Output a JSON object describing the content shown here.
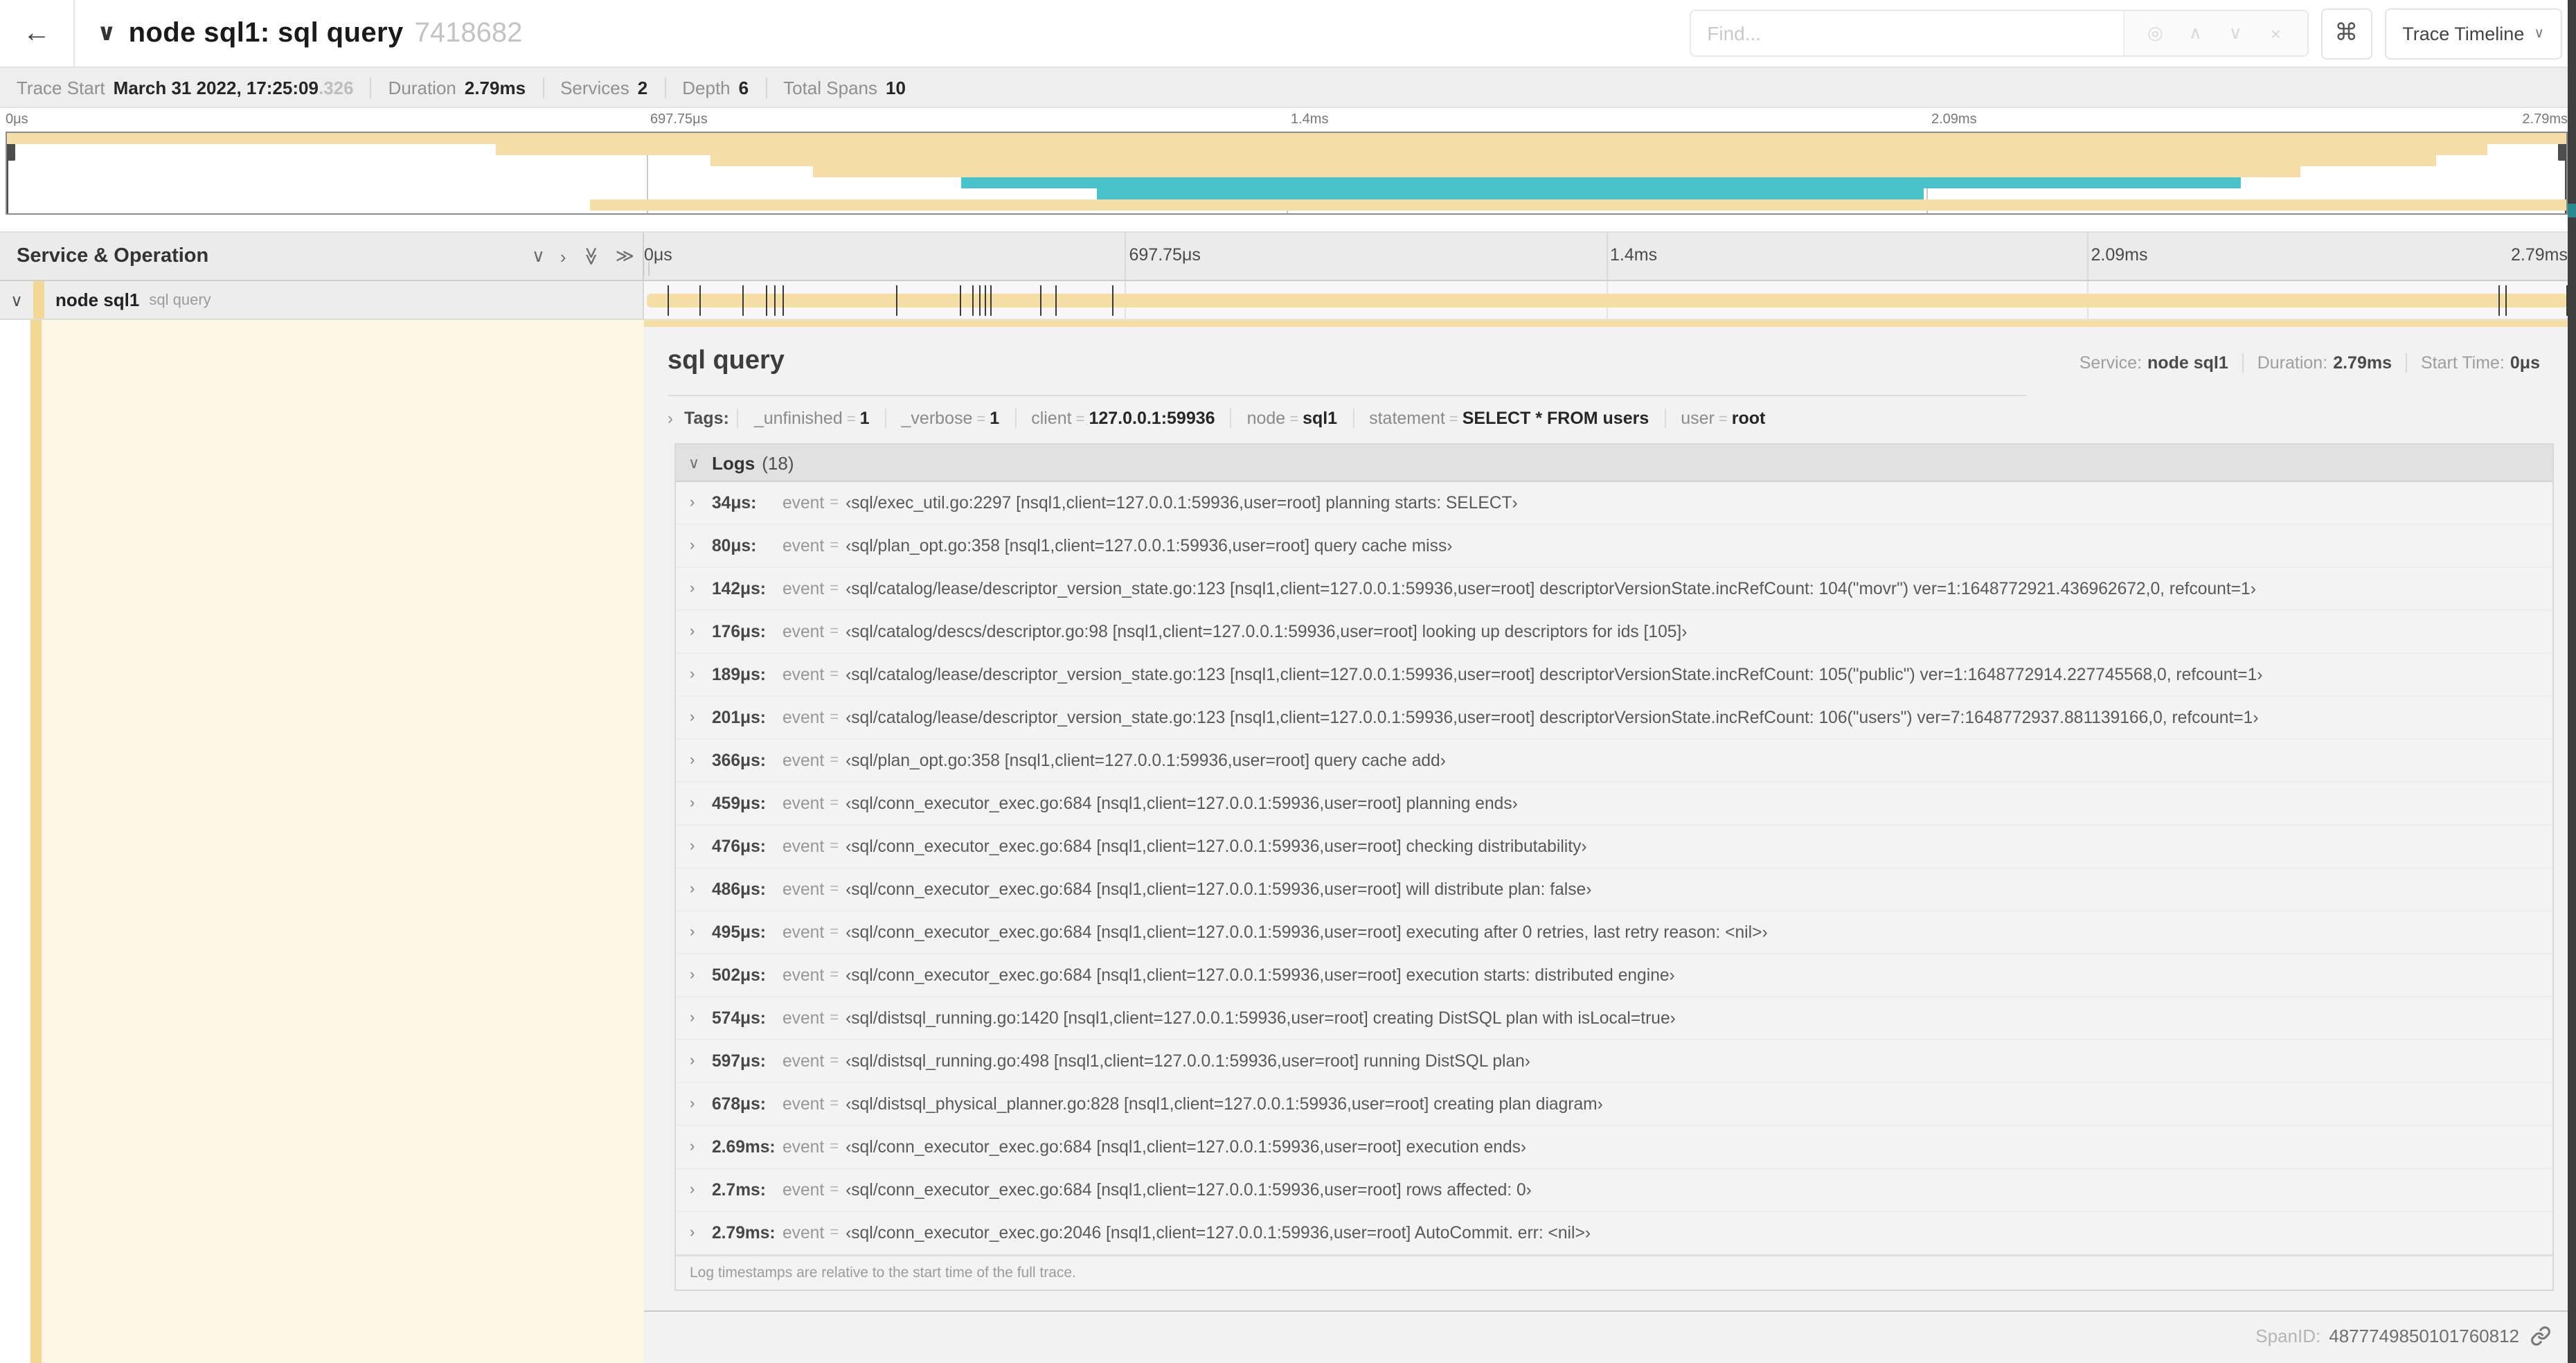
{
  "header": {
    "back": "←",
    "collapse_caret": "∨",
    "title": "node sql1: sql query",
    "trace_id": "7418682",
    "find_placeholder": "Find...",
    "find_icons": {
      "locate": "◎",
      "prev": "∧",
      "next": "∨",
      "clear": "×"
    },
    "shortcut": "⌘",
    "view_select": "Trace Timeline",
    "view_caret": "∨"
  },
  "trace_info": {
    "items": [
      {
        "label": "Trace Start",
        "value": "March 31 2022, 17:25:09",
        "extra": ".326"
      },
      {
        "label": "Duration",
        "value": "2.79ms",
        "extra": ""
      },
      {
        "label": "Services",
        "value": "2",
        "extra": ""
      },
      {
        "label": "Depth",
        "value": "6",
        "extra": ""
      },
      {
        "label": "Total Spans",
        "value": "10",
        "extra": ""
      }
    ]
  },
  "colors": {
    "span_tan": "#f6dfa6",
    "span_tan_dark": "#f3d794",
    "span_teal": "#48c3c9",
    "expanded_cream": "#fdf6e4"
  },
  "minimap": {
    "rows": [
      {
        "start": 0,
        "end": 100,
        "color": "tan"
      },
      {
        "start": 19.1,
        "end": 96.9,
        "color": "tan"
      },
      {
        "start": 27.5,
        "end": 94.9,
        "color": "tan"
      },
      {
        "start": 31.5,
        "end": 89.6,
        "color": "tan"
      },
      {
        "start": 37.3,
        "end": 87.3,
        "color": "teal"
      },
      {
        "start": 42.6,
        "end": 74.9,
        "color": "teal"
      },
      {
        "start": 22.8,
        "end": 100,
        "color": "tan"
      }
    ]
  },
  "timeline": {
    "left_header": "Service & Operation",
    "icons": {
      "collapse_one": "∨",
      "expand_one": "›",
      "collapse_all": "≫",
      "expand_all": "≫"
    },
    "resizer": "||",
    "ticks": [
      {
        "label": "0μs",
        "pos": 0
      },
      {
        "label": "697.75μs",
        "pos": 25
      },
      {
        "label": "1.4ms",
        "pos": 50
      },
      {
        "label": "2.09ms",
        "pos": 75
      },
      {
        "label": "2.79ms",
        "pos": 100
      }
    ],
    "row": {
      "chevron": "∨",
      "service": "node sql1",
      "operation": "sql query",
      "bar": {
        "start": 0.15,
        "end": 100
      },
      "markers": [
        1.22,
        2.87,
        5.09,
        6.31,
        6.78,
        7.2,
        13.12,
        16.45,
        17.06,
        17.42,
        17.74,
        18.0,
        20.57,
        21.4,
        24.3,
        96.42,
        96.77,
        99.95
      ]
    }
  },
  "detail": {
    "operation": "sql query",
    "meta": [
      {
        "label": "Service:",
        "value": "node sql1"
      },
      {
        "label": "Duration:",
        "value": "2.79ms"
      },
      {
        "label": "Start Time:",
        "value": "0μs"
      }
    ],
    "tags": {
      "chevron": "›",
      "title": "Tags:",
      "eq": "=",
      "items": [
        {
          "key": "_unfinished",
          "value": "1"
        },
        {
          "key": "_verbose",
          "value": "1"
        },
        {
          "key": "client",
          "value": "127.0.0.1:59936"
        },
        {
          "key": "node",
          "value": "sql1"
        },
        {
          "key": "statement",
          "value": "SELECT * FROM users"
        },
        {
          "key": "user",
          "value": "root"
        }
      ]
    },
    "logs": {
      "chevron": "∨",
      "row_chevron": "›",
      "title": "Logs",
      "count": "(18)",
      "event_key": "event",
      "eq": "=",
      "entries": [
        {
          "time": "34μs:",
          "value": "‹sql/exec_util.go:2297 [nsql1,client=127.0.0.1:59936,user=root] planning starts: SELECT›"
        },
        {
          "time": "80μs:",
          "value": "‹sql/plan_opt.go:358 [nsql1,client=127.0.0.1:59936,user=root] query cache miss›"
        },
        {
          "time": "142μs:",
          "value": "‹sql/catalog/lease/descriptor_version_state.go:123 [nsql1,client=127.0.0.1:59936,user=root] descriptorVersionState.incRefCount: 104(\"movr\") ver=1:1648772921.436962672,0, refcount=1›"
        },
        {
          "time": "176μs:",
          "value": "‹sql/catalog/descs/descriptor.go:98 [nsql1,client=127.0.0.1:59936,user=root] looking up descriptors for ids [105]›"
        },
        {
          "time": "189μs:",
          "value": "‹sql/catalog/lease/descriptor_version_state.go:123 [nsql1,client=127.0.0.1:59936,user=root] descriptorVersionState.incRefCount: 105(\"public\") ver=1:1648772914.227745568,0, refcount=1›"
        },
        {
          "time": "201μs:",
          "value": "‹sql/catalog/lease/descriptor_version_state.go:123 [nsql1,client=127.0.0.1:59936,user=root] descriptorVersionState.incRefCount: 106(\"users\") ver=7:1648772937.881139166,0, refcount=1›"
        },
        {
          "time": "366μs:",
          "value": "‹sql/plan_opt.go:358 [nsql1,client=127.0.0.1:59936,user=root] query cache add›"
        },
        {
          "time": "459μs:",
          "value": "‹sql/conn_executor_exec.go:684 [nsql1,client=127.0.0.1:59936,user=root] planning ends›"
        },
        {
          "time": "476μs:",
          "value": "‹sql/conn_executor_exec.go:684 [nsql1,client=127.0.0.1:59936,user=root] checking distributability›"
        },
        {
          "time": "486μs:",
          "value": "‹sql/conn_executor_exec.go:684 [nsql1,client=127.0.0.1:59936,user=root] will distribute plan: false›"
        },
        {
          "time": "495μs:",
          "value": "‹sql/conn_executor_exec.go:684 [nsql1,client=127.0.0.1:59936,user=root] executing after 0 retries, last retry reason: <nil>›"
        },
        {
          "time": "502μs:",
          "value": "‹sql/conn_executor_exec.go:684 [nsql1,client=127.0.0.1:59936,user=root] execution starts: distributed engine›"
        },
        {
          "time": "574μs:",
          "value": "‹sql/distsql_running.go:1420 [nsql1,client=127.0.0.1:59936,user=root] creating DistSQL plan with isLocal=true›"
        },
        {
          "time": "597μs:",
          "value": "‹sql/distsql_running.go:498 [nsql1,client=127.0.0.1:59936,user=root] running DistSQL plan›"
        },
        {
          "time": "678μs:",
          "value": "‹sql/distsql_physical_planner.go:828 [nsql1,client=127.0.0.1:59936,user=root] creating plan diagram›"
        },
        {
          "time": "2.69ms:",
          "value": "‹sql/conn_executor_exec.go:684 [nsql1,client=127.0.0.1:59936,user=root] execution ends›"
        },
        {
          "time": "2.7ms:",
          "value": "‹sql/conn_executor_exec.go:684 [nsql1,client=127.0.0.1:59936,user=root] rows affected: 0›"
        },
        {
          "time": "2.79ms:",
          "value": "‹sql/conn_executor_exec.go:2046 [nsql1,client=127.0.0.1:59936,user=root] AutoCommit. err: <nil>›"
        }
      ],
      "footer": "Log timestamps are relative to the start time of the full trace."
    },
    "span_id_label": "SpanID:",
    "span_id": "4877749850101760812"
  }
}
